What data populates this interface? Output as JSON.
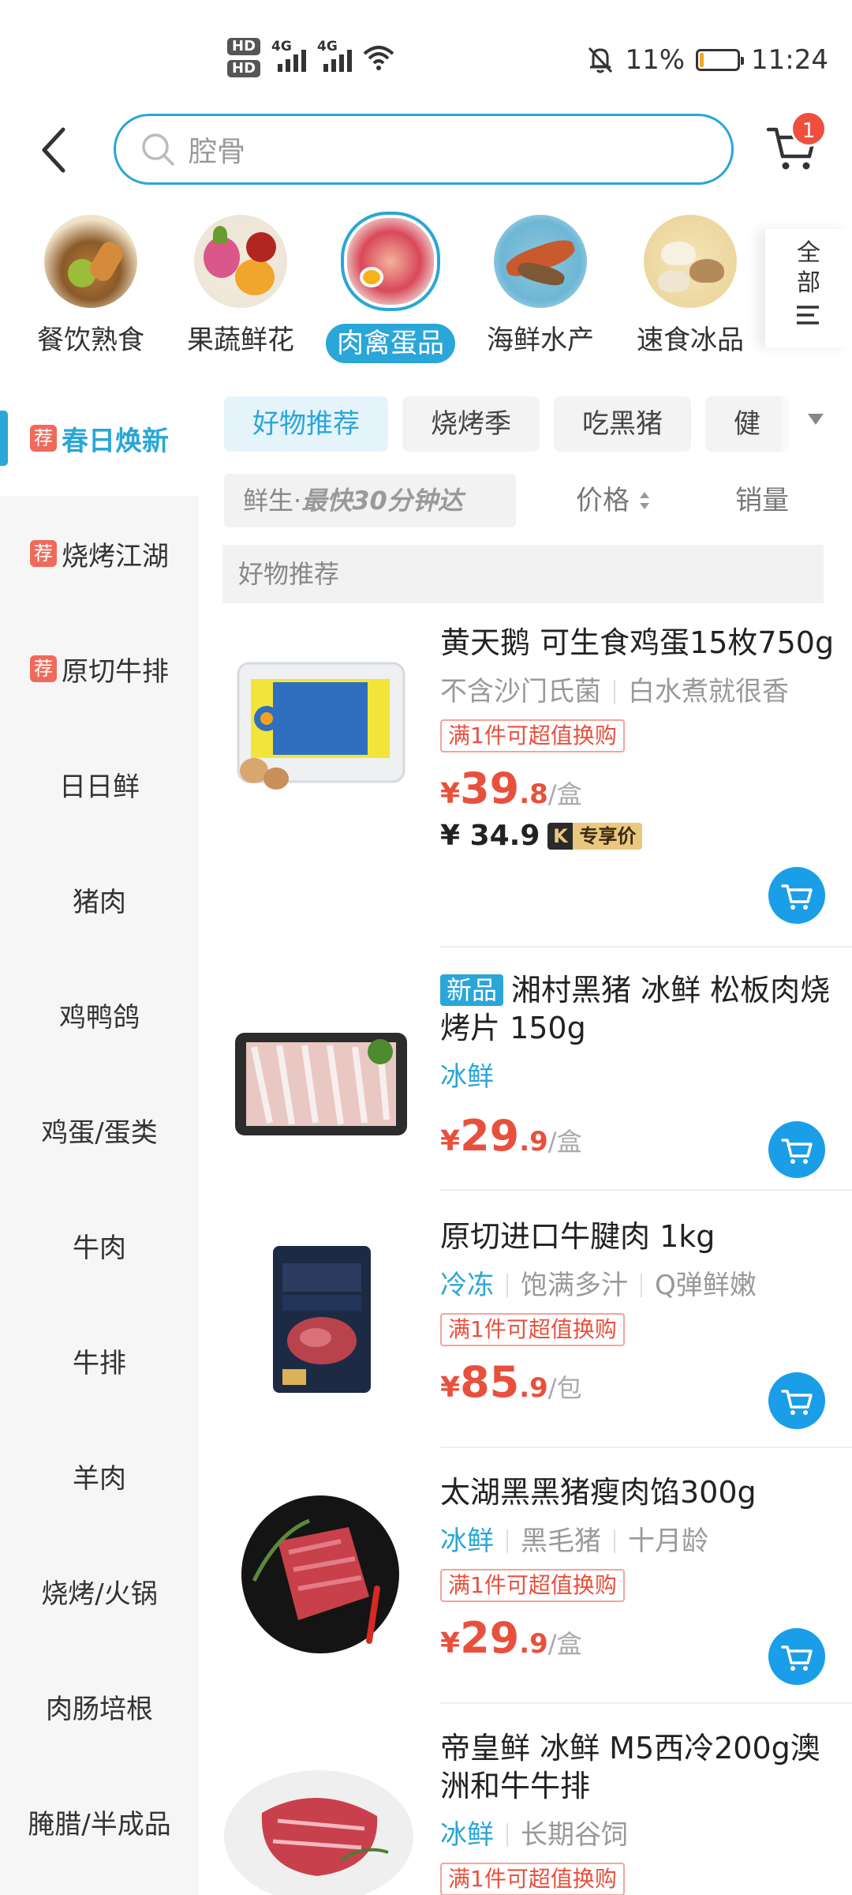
{
  "status_bar": {
    "hd1": "HD",
    "hd2": "HD",
    "net1": "4G",
    "net2": "4G",
    "battery_pct": "11%",
    "battery_level": 0.11,
    "time": "11:24",
    "icons": [
      "wifi-icon",
      "mute-bell-icon",
      "battery-icon"
    ]
  },
  "header": {
    "search_placeholder": "腔骨",
    "cart_count": "1"
  },
  "categories": [
    {
      "label": "餐饮熟食",
      "active": false
    },
    {
      "label": "果蔬鲜花",
      "active": false
    },
    {
      "label": "肉禽蛋品",
      "active": true
    },
    {
      "label": "海鲜水产",
      "active": false
    },
    {
      "label": "速食冰品",
      "active": false
    }
  ],
  "all_categories": {
    "line1": "全",
    "line2": "部"
  },
  "sidebar": {
    "items": [
      {
        "label": "春日焕新",
        "tag": "荐",
        "active": true
      },
      {
        "label": "烧烤江湖",
        "tag": "荐"
      },
      {
        "label": "原切牛排",
        "tag": "荐"
      },
      {
        "label": "日日鲜"
      },
      {
        "label": "猪肉"
      },
      {
        "label": "鸡鸭鸽"
      },
      {
        "label": "鸡蛋/蛋类"
      },
      {
        "label": "牛肉"
      },
      {
        "label": "牛排"
      },
      {
        "label": "羊肉"
      },
      {
        "label": "烧烤/火锅"
      },
      {
        "label": "肉肠培根"
      },
      {
        "label": "腌腊/半成品"
      }
    ]
  },
  "tabs": [
    "好物推荐",
    "烧烤季",
    "吃黑猪",
    "健"
  ],
  "sort": {
    "speed_prefix": "鲜生·",
    "speed_slogan": "最快30分钟达",
    "price": "价格",
    "sales": "销量"
  },
  "section_title": "好物推荐",
  "products": [
    {
      "name": "黄天鹅 可生食鸡蛋15枚750g",
      "attrs": [
        "不含沙门氏菌",
        "白水煮就很香"
      ],
      "promo": "满1件可超值换购",
      "price_int": "39",
      "price_dec": ".8",
      "unit": "/盒",
      "vip_price": "¥ 34.9",
      "vip_label": "专享价"
    },
    {
      "badge": "新品",
      "name": "湘村黑猪 冰鲜 松板肉烧烤片 150g",
      "attrs": [
        "冰鲜"
      ],
      "price_int": "29",
      "price_dec": ".9",
      "unit": "/盒"
    },
    {
      "name": "原切进口牛腱肉 1kg",
      "attrs": [
        "冷冻",
        "饱满多汁",
        "Q弹鲜嫩"
      ],
      "promo": "满1件可超值换购",
      "price_int": "85",
      "price_dec": ".9",
      "unit": "/包"
    },
    {
      "name": "太湖黑黑猪瘦肉馅300g",
      "attrs": [
        "冰鲜",
        "黑毛猪",
        "十月龄"
      ],
      "promo": "满1件可超值换购",
      "price_int": "29",
      "price_dec": ".9",
      "unit": "/盒"
    },
    {
      "name": "帝皇鲜 冰鲜 M5西冷200g澳洲和牛牛排",
      "attrs": [
        "冰鲜",
        "长期谷饲"
      ],
      "promo": "满1件可超值换购"
    }
  ],
  "yen": "¥",
  "colors": {
    "accent": "#2aa6d8",
    "price": "#e8503d",
    "cart_button": "#1a9ee8"
  }
}
